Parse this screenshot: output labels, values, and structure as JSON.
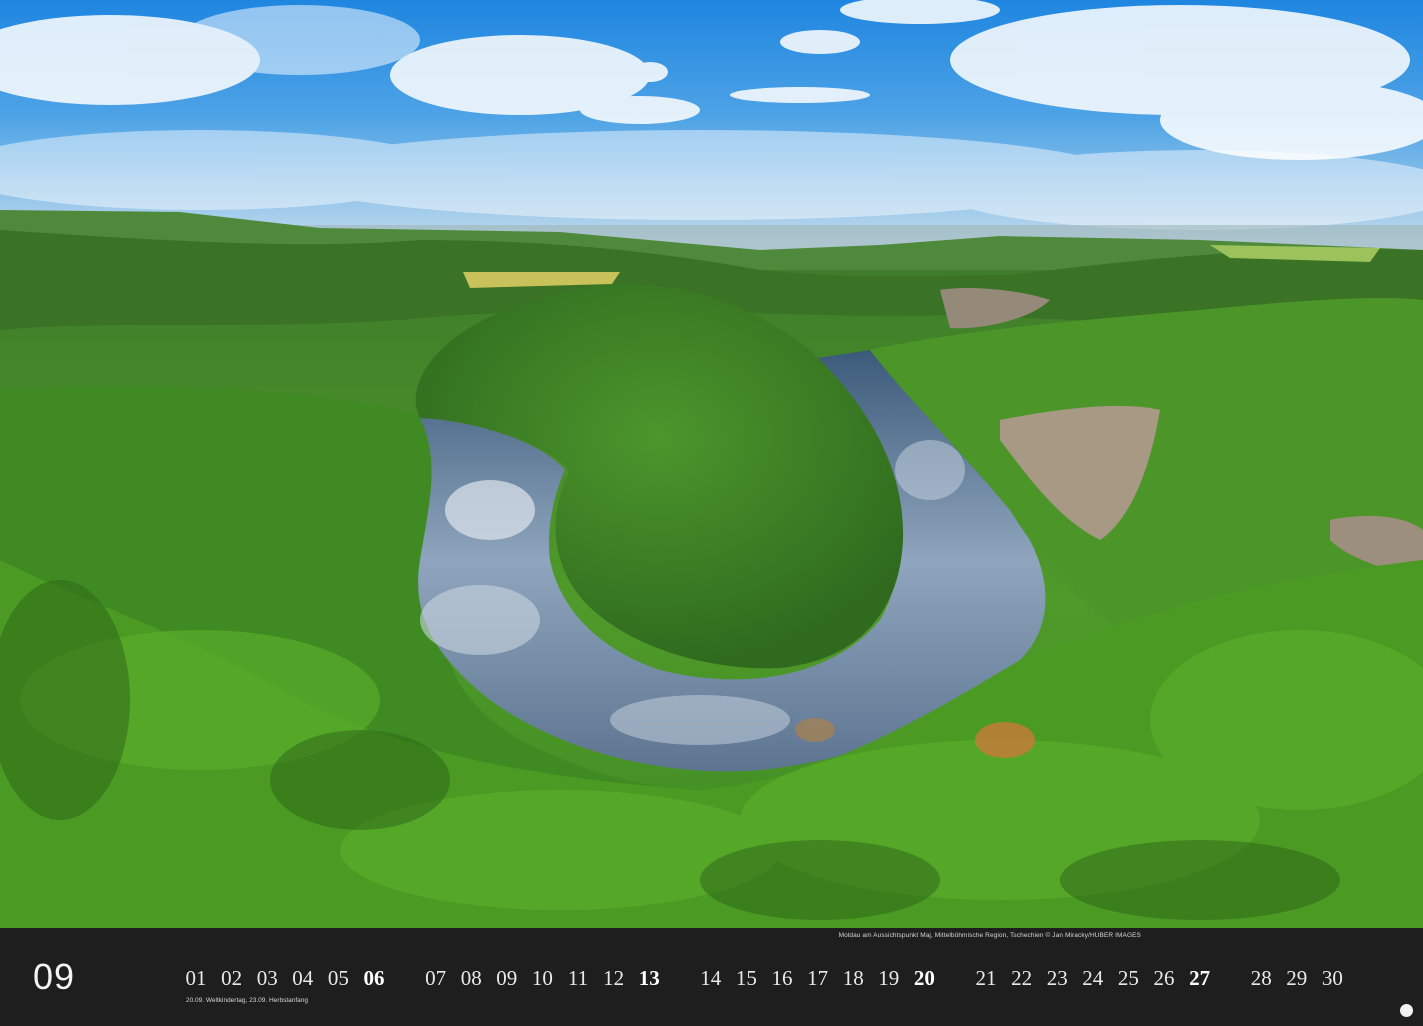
{
  "photo": {
    "caption": "Moldau am Aussichtspunkt Maj, Mittelböhmische Region, Tschechien © Jan Miracky/HUBER IMAGES"
  },
  "calendar": {
    "month": "09",
    "holidays_note": "20.09. Weltkindertag, 23.09. Herbstanfang",
    "days": [
      {
        "label": "01",
        "sunday": false
      },
      {
        "label": "02",
        "sunday": false
      },
      {
        "label": "03",
        "sunday": false
      },
      {
        "label": "04",
        "sunday": false
      },
      {
        "label": "05",
        "sunday": false
      },
      {
        "label": "06",
        "sunday": true
      },
      {
        "label": "07",
        "sunday": false
      },
      {
        "label": "08",
        "sunday": false
      },
      {
        "label": "09",
        "sunday": false
      },
      {
        "label": "10",
        "sunday": false
      },
      {
        "label": "11",
        "sunday": false
      },
      {
        "label": "12",
        "sunday": false
      },
      {
        "label": "13",
        "sunday": true
      },
      {
        "label": "14",
        "sunday": false
      },
      {
        "label": "15",
        "sunday": false
      },
      {
        "label": "16",
        "sunday": false
      },
      {
        "label": "17",
        "sunday": false
      },
      {
        "label": "18",
        "sunday": false
      },
      {
        "label": "19",
        "sunday": false
      },
      {
        "label": "20",
        "sunday": true
      },
      {
        "label": "21",
        "sunday": false
      },
      {
        "label": "22",
        "sunday": false
      },
      {
        "label": "23",
        "sunday": false
      },
      {
        "label": "24",
        "sunday": false
      },
      {
        "label": "25",
        "sunday": false
      },
      {
        "label": "26",
        "sunday": false
      },
      {
        "label": "27",
        "sunday": true
      },
      {
        "label": "28",
        "sunday": false
      },
      {
        "label": "29",
        "sunday": false
      },
      {
        "label": "30",
        "sunday": false
      }
    ]
  }
}
